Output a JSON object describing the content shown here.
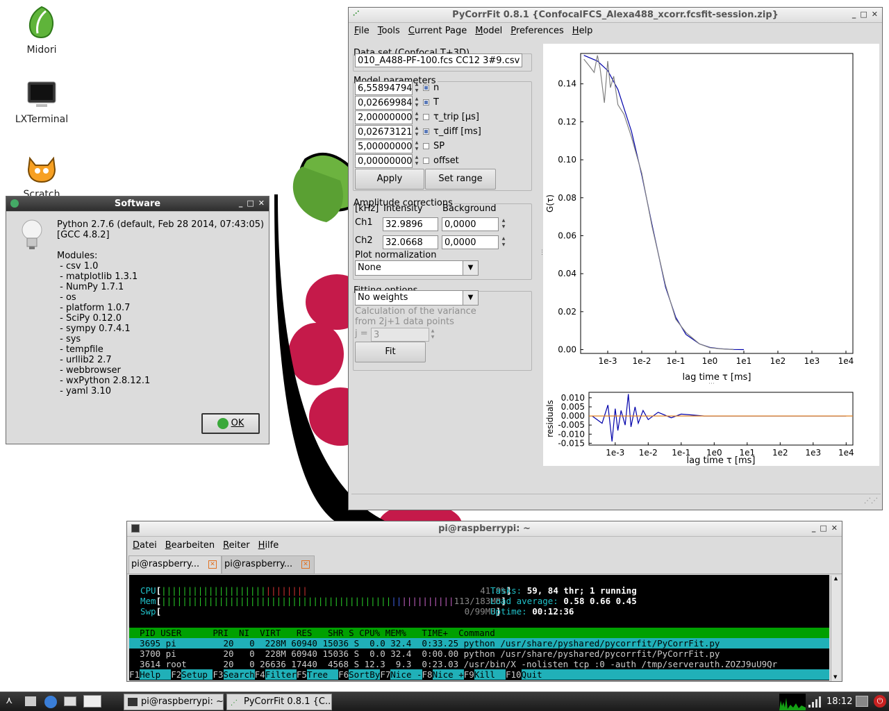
{
  "desktop": {
    "icons": [
      {
        "label": "Midori",
        "icon": "midori-icon"
      },
      {
        "label": "LXTerminal",
        "icon": "terminal-icon"
      },
      {
        "label": "Scratch",
        "icon": "scratch-icon"
      }
    ]
  },
  "about": {
    "title": "Software",
    "lines": [
      "Python 2.7.6 (default, Feb 28 2014, 07:43:05)",
      "[GCC 4.8.2]",
      "",
      "Modules:",
      " - csv 1.0",
      " - matplotlib 1.3.1",
      " - NumPy 1.7.1",
      " - os",
      " - platform 1.0.7",
      " - SciPy 0.12.0",
      " - sympy 0.7.4.1",
      " - sys",
      " - tempfile",
      " - urllib2 2.7",
      " - webbrowser",
      " - wxPython 2.8.12.1",
      " - yaml 3.10"
    ],
    "ok_label": "OK"
  },
  "pycorrfit": {
    "title": "PyCorrFit 0.8.1 {ConfocalFCS_Alexa488_xcorr.fcsfit-session.zip}",
    "menu": [
      "File",
      "Tools",
      "Current Page",
      "Model",
      "Preferences",
      "Help"
    ],
    "dataset_title": "Data set (Confocal T+3D)",
    "dataset_value": "010_A488-PF-100.fcs CC12 3#9.csv r",
    "model_title": "Model parameters",
    "params": [
      {
        "value": "6,55894794",
        "name": "n",
        "checked": true
      },
      {
        "value": "0,02669984",
        "name": "T",
        "checked": true
      },
      {
        "value": "2,00000000",
        "name": "τ_trip [µs]",
        "checked": false
      },
      {
        "value": "0,02673121",
        "name": "τ_diff [ms]",
        "checked": true
      },
      {
        "value": "5,00000000",
        "name": "SP",
        "checked": false
      },
      {
        "value": "0,00000000",
        "name": "offset",
        "checked": false
      }
    ],
    "apply_label": "Apply",
    "setrange_label": "Set range",
    "amp_title": "Amplitude corrections",
    "amp_unit": "[kHz]",
    "amp_intensity": "Intensity",
    "amp_background": "Background",
    "ch1_label": "Ch1",
    "ch1_intensity": "32.9896",
    "ch1_background": "0,0000",
    "ch2_label": "Ch2",
    "ch2_intensity": "32.0668",
    "ch2_background": "0,0000",
    "norm_label": "Plot normalization",
    "norm_value": "None",
    "fit_title": "Fitting options",
    "weights_value": "No weights",
    "variance_line1": "Calculation of the variance",
    "variance_line2": "from 2j+1 data points",
    "j_label": "j =",
    "j_value": "3",
    "fit_label": "Fit"
  },
  "chart_data": [
    {
      "type": "line",
      "title": "",
      "xlabel": "lag time τ [ms]",
      "ylabel": "G(τ)",
      "x_scale": "log",
      "xlim": [
        0.00016,
        16000
      ],
      "ylim": [
        -0.002,
        0.156
      ],
      "xticks": [
        "1e-3",
        "1e-2",
        "1e-1",
        "1e0",
        "1e1",
        "1e2",
        "1e3",
        "1e4"
      ],
      "yticks": [
        "0.00",
        "0.02",
        "0.04",
        "0.06",
        "0.08",
        "0.10",
        "0.12",
        "0.14"
      ],
      "series": [
        {
          "color": "#0000aa",
          "x": [
            0.0002,
            0.0005,
            0.001,
            0.002,
            0.005,
            0.01,
            0.02,
            0.05,
            0.1,
            0.2,
            0.5,
            1,
            2,
            5,
            10
          ],
          "y": [
            0.155,
            0.152,
            0.147,
            0.137,
            0.115,
            0.092,
            0.066,
            0.033,
            0.017,
            0.008,
            0.003,
            0.0012,
            0.0005,
            0.0001,
            0.0
          ]
        },
        {
          "color": "#808080",
          "x": [
            0.0002,
            0.0003,
            0.0004,
            0.0005,
            0.0006,
            0.0008,
            0.001,
            0.0012,
            0.0015,
            0.002,
            0.003,
            0.005,
            0.01,
            0.02,
            0.05,
            0.1,
            0.2,
            0.5,
            1,
            2,
            5
          ],
          "y": [
            0.153,
            0.149,
            0.146,
            0.155,
            0.148,
            0.13,
            0.152,
            0.138,
            0.144,
            0.129,
            0.124,
            0.112,
            0.093,
            0.065,
            0.034,
            0.016,
            0.009,
            0.003,
            0.001,
            0.0004,
            0.0
          ]
        }
      ]
    },
    {
      "type": "line",
      "title": "",
      "xlabel": "lag time τ [ms]",
      "ylabel": "residuals",
      "x_scale": "log",
      "xlim": [
        0.00016,
        16000
      ],
      "ylim": [
        -0.016,
        0.013
      ],
      "xticks": [
        "1e-3",
        "1e-2",
        "1e-1",
        "1e0",
        "1e1",
        "1e2",
        "1e3",
        "1e4"
      ],
      "yticks": [
        "0.010",
        "0.005",
        "0.000",
        "-0.005",
        "-0.010",
        "-0.015"
      ],
      "series": [
        {
          "color": "#0000aa",
          "x": [
            0.0002,
            0.0004,
            0.0006,
            0.0008,
            0.001,
            0.0012,
            0.0015,
            0.002,
            0.0025,
            0.003,
            0.004,
            0.005,
            0.007,
            0.01,
            0.02,
            0.05,
            0.1,
            0.5,
            1,
            5,
            10,
            10000
          ],
          "y": [
            0.0,
            -0.004,
            0.006,
            -0.014,
            0.004,
            -0.008,
            0.003,
            -0.005,
            0.012,
            -0.006,
            0.005,
            -0.004,
            0.003,
            -0.002,
            0.002,
            -0.001,
            0.001,
            0.0,
            0.0,
            0.0,
            0.0,
            0.0
          ]
        },
        {
          "color": "#e08020",
          "x": [
            0.00016,
            16000
          ],
          "y": [
            0.0,
            0.0
          ]
        }
      ]
    }
  ],
  "terminal": {
    "title": "pi@raspberrypi: ~",
    "menu": [
      "Datei",
      "Bearbeiten",
      "Reiter",
      "Hilfe"
    ],
    "tabs": [
      "pi@raspberry...",
      "pi@raspberry..."
    ],
    "cpu_label": "CPU",
    "cpu_value": "41.9%",
    "mem_label": "Mem",
    "mem_value": "113/183MB",
    "swp_label": "Swp",
    "swp_value": "0/99MB",
    "tasks_label": "Tasks:",
    "tasks_value": "59, 84 thr; 1 running",
    "load_label": "Load average:",
    "load_value": "0.58 0.66 0.45",
    "uptime_label": "Uptime:",
    "uptime_value": "00:12:36",
    "header": "  PID USER      PRI  NI  VIRT   RES   SHR S CPU% MEM%   TIME+  Command",
    "procs": [
      "  3695 pi         20   0  228M 60940 15036 S  0.0 32.4  0:33.25 python /usr/share/pyshared/pycorrfit/PyCorrFit.py",
      "  3700 pi         20   0  228M 60940 15036 S  0.0 32.4  0:00.00 python /usr/share/pyshared/pycorrfit/PyCorrFit.py",
      "  3614 root       20   0 26636 17440  4568 S 12.3  9.3  0:23.03 /usr/bin/X -nolisten tcp :0 -auth /tmp/serverauth.ZOZJ9uU9Qr"
    ],
    "fkeys": [
      {
        "key": "F1",
        "label": "Help  "
      },
      {
        "key": "F2",
        "label": "Setup "
      },
      {
        "key": "F3",
        "label": "Search"
      },
      {
        "key": "F4",
        "label": "Filter"
      },
      {
        "key": "F5",
        "label": "Tree  "
      },
      {
        "key": "F6",
        "label": "SortBy"
      },
      {
        "key": "F7",
        "label": "Nice -"
      },
      {
        "key": "F8",
        "label": "Nice +"
      },
      {
        "key": "F9",
        "label": "Kill  "
      },
      {
        "key": "F10",
        "label": "Quit"
      }
    ]
  },
  "taskbar": {
    "tasks": [
      "pi@raspberrypi: ~",
      "PyCorrFit 0.8.1 {C..."
    ],
    "clock": "18:12"
  }
}
